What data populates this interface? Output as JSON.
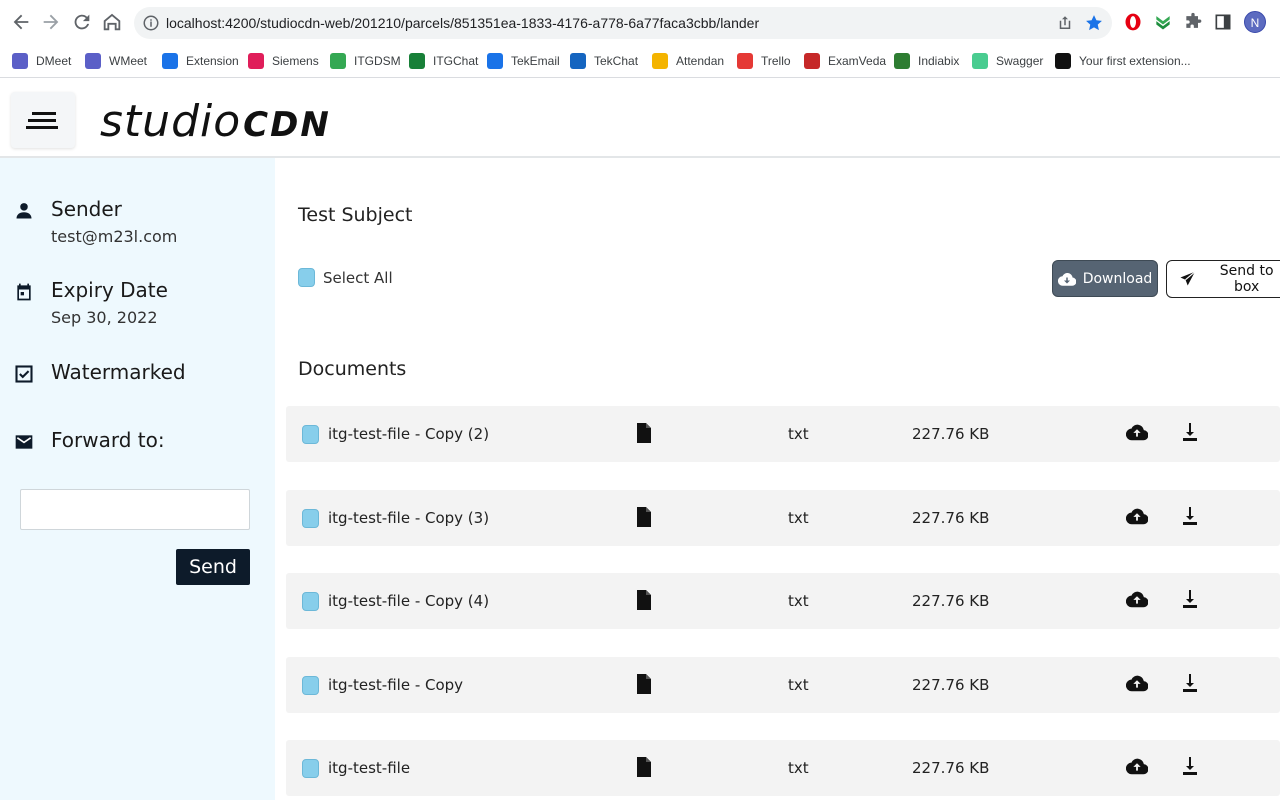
{
  "browser": {
    "url": "localhost:4200/studiocdn-web/201210/parcels/851351ea-1833-4176-a778-6a77faca3cbb/lander",
    "profile_initial": "N",
    "bookmarks": [
      {
        "label": "DMeet",
        "icon": "teams-icon",
        "color": "#5b5fc7"
      },
      {
        "label": "WMeet",
        "icon": "teams-icon",
        "color": "#5b5fc7"
      },
      {
        "label": "Extension",
        "icon": "puzzle-icon",
        "color": "#1a73e8"
      },
      {
        "label": "Siemens",
        "icon": "slack-icon",
        "color": "#e01e5a"
      },
      {
        "label": "ITGDSM",
        "icon": "itgdsm-icon",
        "color": "#34a853"
      },
      {
        "label": "ITGChat",
        "icon": "chat-icon",
        "color": "#188038"
      },
      {
        "label": "TekEmail",
        "icon": "mail-icon",
        "color": "#1a73e8"
      },
      {
        "label": "TekChat",
        "icon": "tekchat-icon",
        "color": "#1565c0"
      },
      {
        "label": "Attendan",
        "icon": "attendance-icon",
        "color": "#f4b400"
      },
      {
        "label": "Trello",
        "icon": "trello-icon",
        "color": "#e53935"
      },
      {
        "label": "ExamVeda",
        "icon": "examveda-icon",
        "color": "#c62828"
      },
      {
        "label": "Indiabix",
        "icon": "indiabix-icon",
        "color": "#2e7d32"
      },
      {
        "label": "Swagger",
        "icon": "swagger-icon",
        "color": "#49cc90"
      },
      {
        "label": "Your first extension...",
        "icon": "m-icon",
        "color": "#111111"
      }
    ]
  },
  "app": {
    "logo_light": "studio",
    "logo_bold": "CDN"
  },
  "sidebar": {
    "sender_label": "Sender",
    "sender_value": "test@m23l.com",
    "expiry_label": "Expiry Date",
    "expiry_value": "Sep 30, 2022",
    "watermarked_label": "Watermarked",
    "forward_label": "Forward to:",
    "forward_value": "",
    "send_label": "Send"
  },
  "main": {
    "subject": "Test Subject",
    "select_all_label": "Select All",
    "download_label": "Download",
    "send_to_box_label": "Send to box",
    "documents_heading": "Documents",
    "documents": [
      {
        "name": "itg-test-file - Copy (2)",
        "ext": "txt",
        "size": "227.76 KB"
      },
      {
        "name": "itg-test-file - Copy (3)",
        "ext": "txt",
        "size": "227.76 KB"
      },
      {
        "name": "itg-test-file - Copy (4)",
        "ext": "txt",
        "size": "227.76 KB"
      },
      {
        "name": "itg-test-file - Copy",
        "ext": "txt",
        "size": "227.76 KB"
      },
      {
        "name": "itg-test-file",
        "ext": "txt",
        "size": "227.76 KB"
      }
    ]
  },
  "colors": {
    "sidebar_bg": "#eef9fe",
    "checkbox": "#87ceeb",
    "download_btn": "#566473",
    "send_btn": "#0d1b2a",
    "row_bg": "#f3f3f3"
  }
}
